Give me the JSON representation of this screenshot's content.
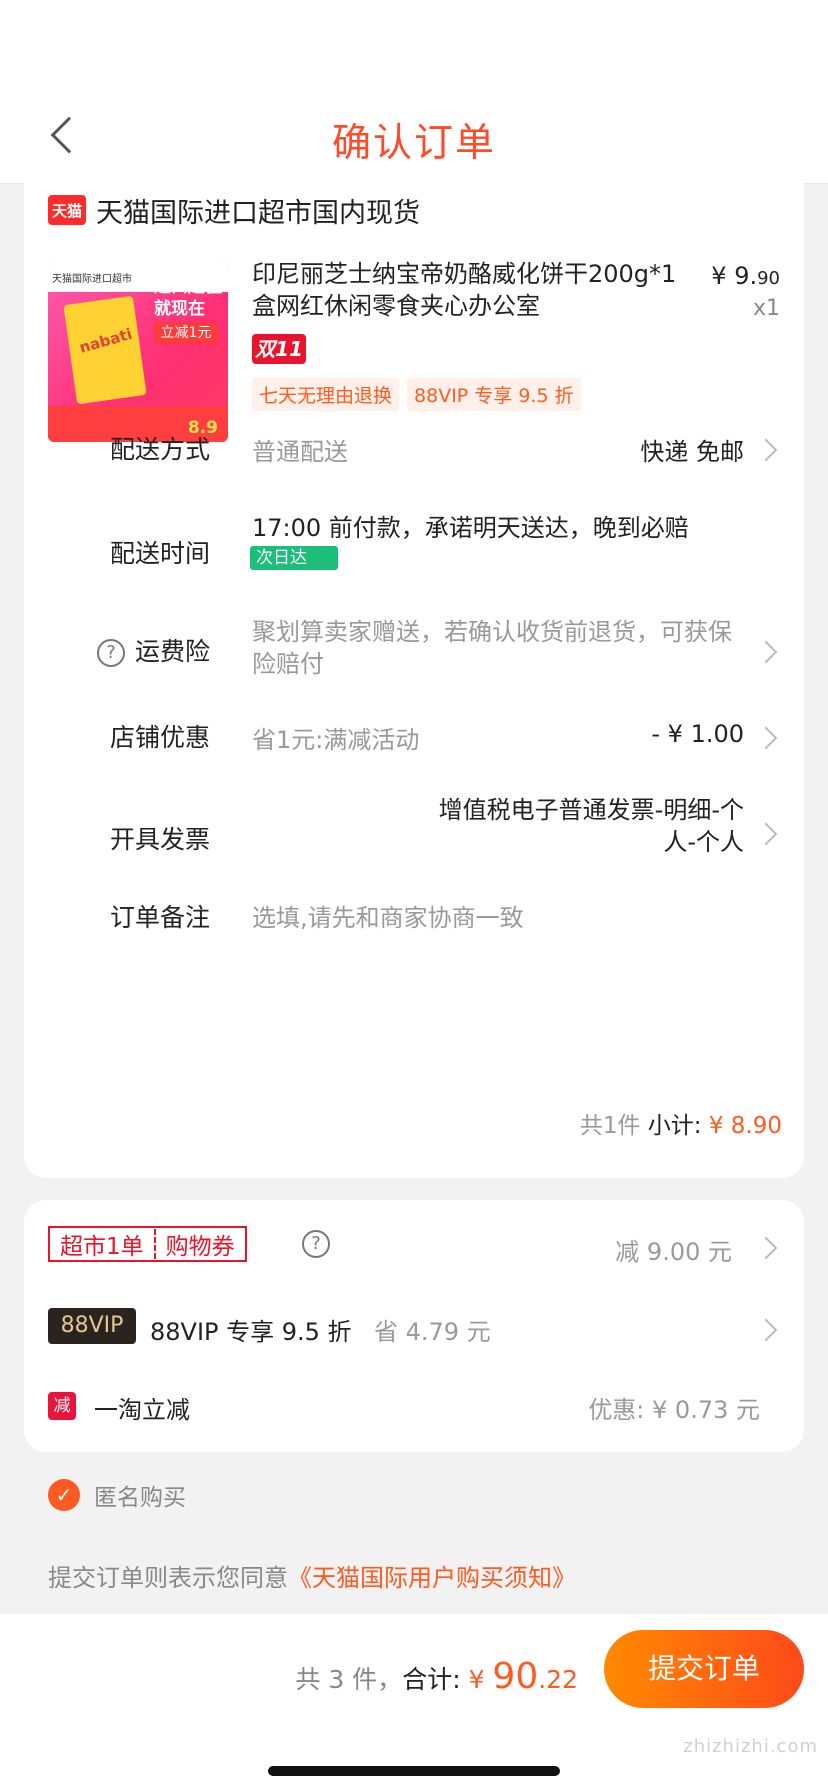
{
  "header": {
    "title": "确认订单"
  },
  "shop": {
    "logo_text": "天猫",
    "name": "天猫国际进口超市国内现货"
  },
  "product": {
    "image_text": {
      "top": "天猫国际进口超市",
      "headline": "进口超值就现在",
      "badge": "立减1元",
      "brand": "nabati",
      "price": "8.9"
    },
    "title": "印尼丽芝士纳宝帝奶酪威化饼干200g*1盒网红休闲零食夹心办公室",
    "price_main": "¥ 9.",
    "price_dec": "90",
    "qty": "x1",
    "promo_tag": "双11",
    "service_tags": [
      "七天无理由退换",
      "88VIP 专享 9.5 折"
    ]
  },
  "rows": {
    "delivery": {
      "label": "配送方式",
      "value": "普通配送",
      "right": "快递 免邮"
    },
    "delivery_time": {
      "label": "配送时间",
      "value": "17:00 前付款，承诺明天送达，晚到必赔",
      "badge": "次日达"
    },
    "insurance": {
      "label": "运费险",
      "help": "?",
      "value": "聚划算卖家赠送，若确认收货前退货，可获保险赔付"
    },
    "shop_discount": {
      "label": "店铺优惠",
      "value": "省1元:满减活动",
      "right": "- ¥ 1.00"
    },
    "invoice": {
      "label": "开具发票",
      "right": "增值税电子普通发票-明细-个人-个人"
    },
    "note": {
      "label": "订单备注",
      "placeholder": "选填,请先和商家协商一致"
    }
  },
  "subtotal": {
    "count": "共1件",
    "label": "小计:",
    "amount": "¥ 8.90"
  },
  "discounts": {
    "coupon": {
      "part1": "超市1单",
      "part2": "购物券",
      "help": "?",
      "right": "减 9.00 元"
    },
    "vip": {
      "badge": "88VIP",
      "label": "88VIP 专享 9.5 折",
      "save": "省 4.79 元"
    },
    "taobao": {
      "badge": "减",
      "label": "一淘立减",
      "right": "优惠: ¥ 0.73 元"
    }
  },
  "anonymous": {
    "label": "匿名购买"
  },
  "agreement": {
    "prefix": "提交订单则表示您同意",
    "link": "《天猫国际用户购买须知》"
  },
  "footer": {
    "count": "共 3 件，",
    "total_label": "合计: ",
    "currency": "¥ ",
    "amount_int": "90",
    "amount_dec": ".22",
    "submit": "提交订单",
    "watermark": "zhizhizhi.com"
  }
}
